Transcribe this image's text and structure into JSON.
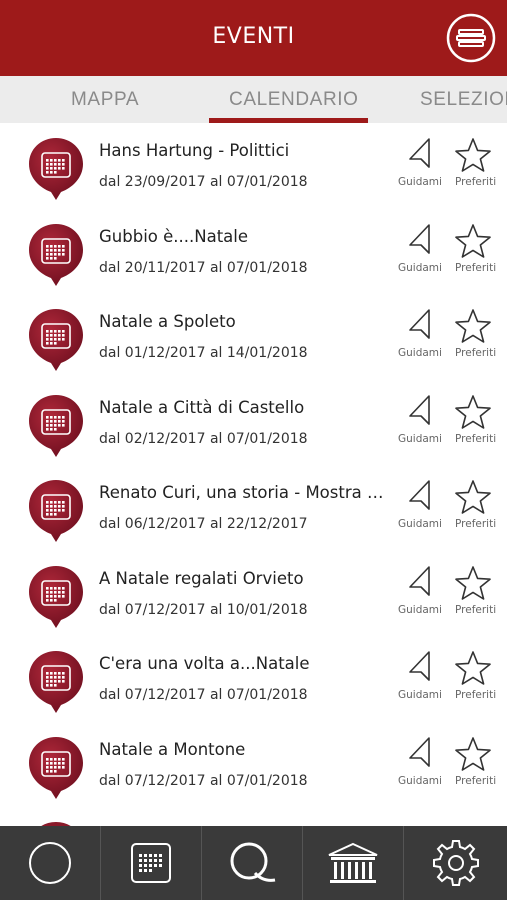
{
  "header": {
    "title": "EVENTI",
    "menu_icon": "menu-icon"
  },
  "tabs": [
    {
      "label": "MAPPA",
      "active": false
    },
    {
      "label": "CALENDARIO",
      "active": true
    },
    {
      "label": "SELEZION",
      "active": false
    }
  ],
  "events": [
    {
      "title": "Hans Hartung - Polittici",
      "dates": "dal 23/09/2017 al 07/01/2018"
    },
    {
      "title": "Gubbio è....Natale",
      "dates": "dal 20/11/2017 al 07/01/2018"
    },
    {
      "title": "Natale a Spoleto",
      "dates": "dal 01/12/2017 al 14/01/2018"
    },
    {
      "title": "Natale a Città di Castello",
      "dates": "dal 02/12/2017 al 07/01/2018"
    },
    {
      "title": "Renato Curi, una storia - Mostra fotografica",
      "dates": "dal 06/12/2017 al 22/12/2017"
    },
    {
      "title": "A Natale regalati Orvieto",
      "dates": "dal 07/12/2017 al 10/01/2018"
    },
    {
      "title": "C'era una volta a...Natale",
      "dates": "dal 07/12/2017 al 07/01/2018"
    },
    {
      "title": "Natale a Montone",
      "dates": "dal 07/12/2017 al 07/01/2018"
    }
  ],
  "actions": {
    "guide_label": "Guidami",
    "favorite_label": "Preferiti"
  },
  "bottom_nav": [
    {
      "icon": "circle-icon"
    },
    {
      "icon": "calendar-icon"
    },
    {
      "icon": "q-icon"
    },
    {
      "icon": "museum-icon"
    },
    {
      "icon": "gear-icon"
    }
  ],
  "colors": {
    "brand_red": "#9e1a1a",
    "bottom_bar": "#3a3a3a",
    "tab_bar": "#ececec"
  }
}
